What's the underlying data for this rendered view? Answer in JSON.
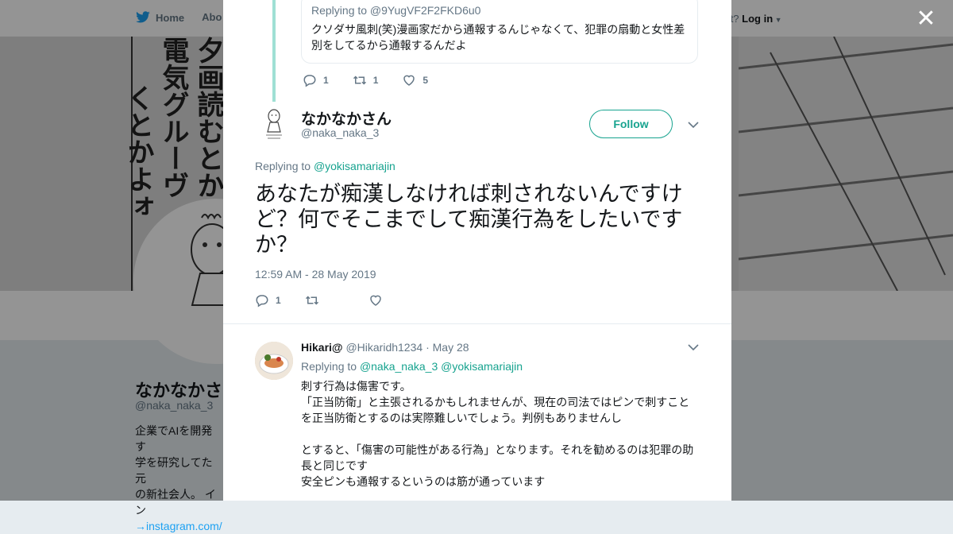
{
  "topbar": {
    "home_label": "Home",
    "about_label": "Abo",
    "login_prompt": "ccount?",
    "login_label": "Log in"
  },
  "background_profile": {
    "name": "なかなかさ",
    "handle": "@naka_naka_3",
    "bio_lines": [
      "企業でAIを開発す",
      "学を研究してた元",
      "の新社会人。 イン"
    ],
    "bio_link": "→instagram.com/",
    "banner_text": [
      "電気グルーヴ",
      "くとかよォ",
      "夕画読むとか"
    ]
  },
  "previous_tweet": {
    "replying_to": "Replying to @9YugVF2F2FKD6u0",
    "text": "クソダサ風刺(笑)漫画家だから通報するんじゃなくて、犯罪の扇動と女性差別をしてるから通報するんだよ",
    "reply_count": "1",
    "retweet_count": "1",
    "like_count": "5"
  },
  "main_tweet": {
    "display_name": "なかなかさん",
    "handle": "@naka_naka_3",
    "follow_label": "Follow",
    "replying_prefix": "Replying to",
    "replying_handle": "@yokisamariajin",
    "text": "あなたが痴漢しなければ刺されないんですけど？何でそこまでして痴漢行為をしたいですか？",
    "timestamp": "12:59 AM - 28 May 2019",
    "reply_count": "1"
  },
  "reply_tweet": {
    "display_name": "Hikari@",
    "handle": "@Hikaridh1234",
    "date": "· May 28",
    "replying_prefix": "Replying to",
    "replying_handle_1": "@naka_naka_3",
    "replying_handle_2": "@yokisamariajin",
    "text": "刺す行為は傷害です。\n「正当防衛」と主張されるかもしれませんが、現在の司法ではピンで刺すことを正当防衛とするのは実際難しいでしょう。判例もありませんし\n\nとすると、「傷害の可能性がある行為」となります。それを勧めるのは犯罪の助長と同じです\n安全ピンも通報するというのは筋が通っています"
  },
  "colors": {
    "accent": "#17a38f",
    "link": "#1da1f2",
    "muted": "#657786",
    "overlay": "rgba(0,0,0,0.42)"
  },
  "icons": [
    "bird-icon",
    "close-icon",
    "reply-icon",
    "retweet-icon",
    "like-icon",
    "chevron-down-icon"
  ]
}
